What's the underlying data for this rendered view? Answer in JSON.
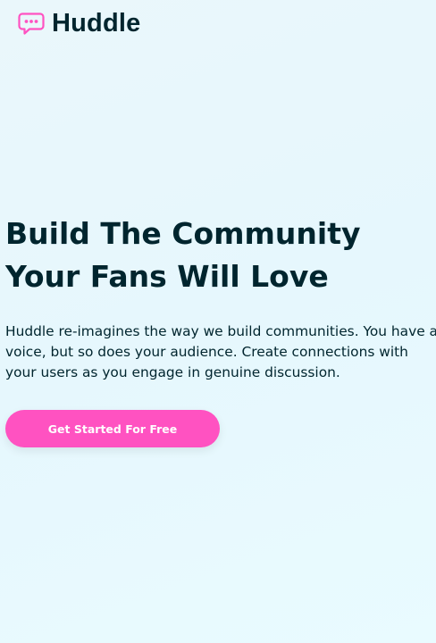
{
  "header": {
    "logo_icon": "chat-bubble-icon",
    "logo_text": "Huddle"
  },
  "hero": {
    "title_line1": "Build The Community",
    "title_line2": "Your Fans Will Love",
    "description": "Huddle re-imagines the way we build communities. You have a voice, but so does your audience. Create connections with your users as you engage in genuine discussion.",
    "cta_label": "Get Started For Free"
  },
  "colors": {
    "text": "#00252e",
    "accent_pink": "#ff52c1",
    "background": "#e6f7fd"
  }
}
